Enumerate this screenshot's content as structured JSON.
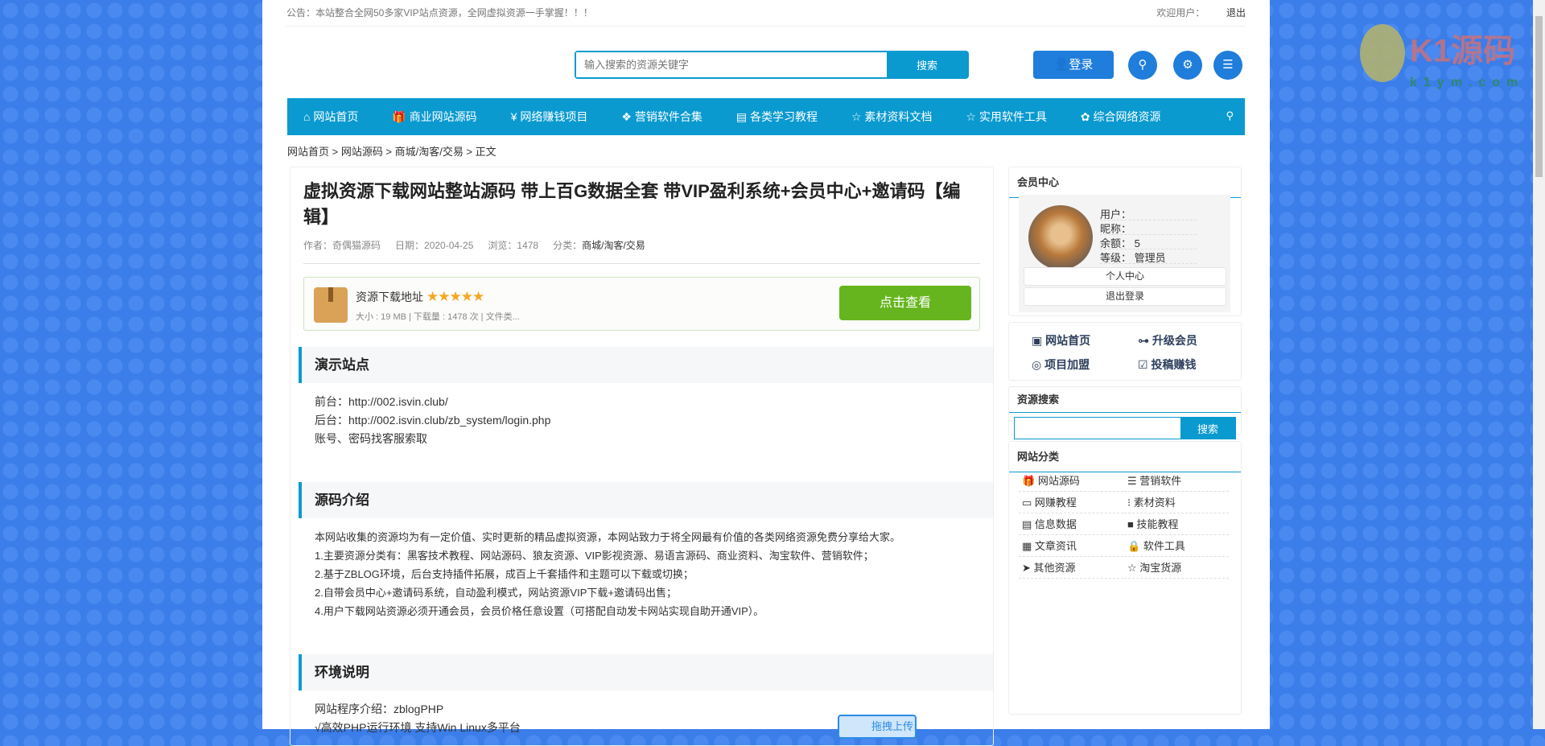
{
  "topbar": {
    "notice": "公告：本站整合全网50多家VIP站点资源，全网虚拟资源一手掌握！！！",
    "welcome": "欢迎用户：",
    "logout": "退出"
  },
  "header": {
    "search_placeholder": "输入搜索的资源关键字",
    "search_button": "搜索",
    "login": "登录"
  },
  "nav": [
    "网站首页",
    "商业网站源码",
    "网络赚钱项目",
    "营销软件合集",
    "各类学习教程",
    "素材资料文档",
    "实用软件工具",
    "综合网络资源"
  ],
  "breadcrumb": "网站首页 > 网站源码 > 商城/淘客/交易 > 正文",
  "article": {
    "title": "虚拟资源下载网站整站源码 带上百G数据全套 带VIP盈利系统+会员中心+邀请码【编辑】",
    "author": "作者：奇偶猫源码",
    "date": "日期：2020-04-25",
    "views": "浏览：1478",
    "category_label": "分类：",
    "category": "商城/淘客/交易",
    "download": {
      "title": "资源下载地址",
      "stars": "★★★★★",
      "rating": 5,
      "info": "大小 : 19 MB | 下载量 : 1478 次 | 文件类...",
      "button": "点击查看"
    },
    "sections": [
      {
        "heading": "演示站点",
        "lines": [
          "前台：http://002.isvin.club/",
          "后台：http://002.isvin.club/zb_system/login.php",
          "账号、密码找客服索取"
        ]
      },
      {
        "heading": "源码介绍",
        "lines": [
          "本网站收集的资源均为有一定价值、实时更新的精品虚拟资源，本网站致力于将全网最有价值的各类网络资源免费分享给大家。",
          "1.主要资源分类有：黑客技术教程、网站源码、狼友资源、VIP影视资源、易语言源码、商业资料、淘宝软件、营销软件；",
          "2.基于ZBLOG环境，后台支持插件拓展，成百上千套插件和主题可以下载或切换；",
          "2.自带会员中心+邀请码系统，自动盈利模式，网站资源VIP下载+邀请码出售；",
          "4.用户下载网站资源必须开通会员，会员价格任意设置（可搭配自动发卡网站实现自助开通VIP）。"
        ]
      },
      {
        "heading": "环境说明",
        "lines": [
          "网站程序介绍：zblogPHP",
          "√高效PHP运行环境 支持Win Linux多平台"
        ]
      }
    ],
    "upload_button": "拖拽上传"
  },
  "sidebar": {
    "member": {
      "title": "会员中心",
      "user": "用户：",
      "nick": "昵称：",
      "balance_label": "余额：",
      "balance": "5",
      "level_label": "等级：",
      "level": "管理员",
      "center": "个人中心",
      "logout": "退出登录"
    },
    "quick": [
      "网站首页",
      "升级会员",
      "项目加盟",
      "投稿赚钱"
    ],
    "search": {
      "title": "资源搜索",
      "button": "搜索"
    },
    "categories": {
      "title": "网站分类",
      "items": [
        "网站源码",
        "营销软件",
        "网赚教程",
        "素材资料",
        "信息数据",
        "技能教程",
        "文章资讯",
        "软件工具",
        "其他资源",
        "淘宝货源"
      ]
    }
  },
  "watermark": {
    "brand": "K1源码",
    "domain": "k1ym.com"
  }
}
